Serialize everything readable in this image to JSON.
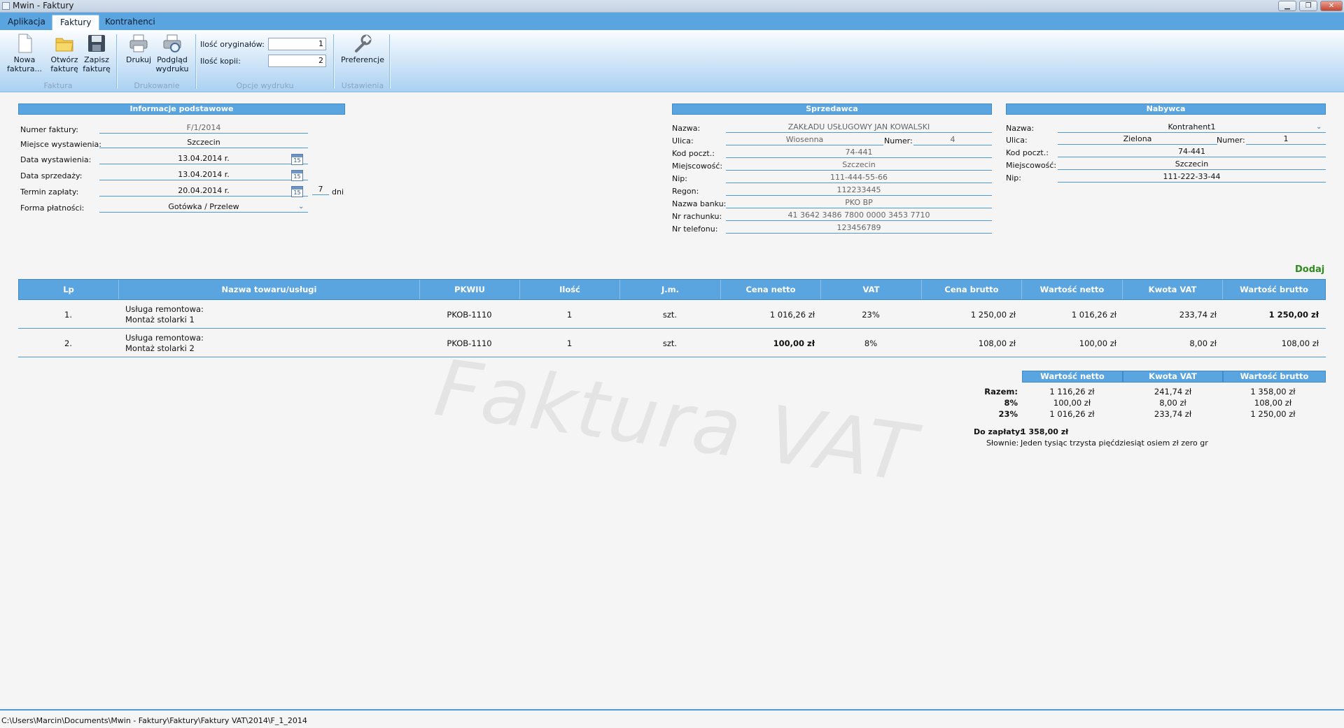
{
  "window": {
    "title": "Mwin - Faktury",
    "minimize": "▁",
    "maximize": "❐",
    "close": "✕"
  },
  "tabs": [
    "Aplikacja",
    "Faktury",
    "Kontrahenci"
  ],
  "ribbon": {
    "new_invoice": "Nowa faktura...",
    "new_invoice_line1": "Nowa",
    "new_invoice_line2": "faktura...",
    "open_line1": "Otwórz",
    "open_line2": "fakturę",
    "save_line1": "Zapisz",
    "save_line2": "fakturę",
    "print": "Drukuj",
    "preview_line1": "Podgląd",
    "preview_line2": "wydruku",
    "originals_label": "Ilość oryginałów:",
    "originals_value": "1",
    "copies_label": "Ilość kopii:",
    "copies_value": "2",
    "preferences": "Preferencje",
    "group_faktura": "Faktura",
    "group_drukowanie": "Drukowanie",
    "group_opcje": "Opcje wydruku",
    "group_ustawienia": "Ustawienia"
  },
  "basic_info": {
    "header": "Informacje podstawowe",
    "number_label": "Numer faktury:",
    "number": "F/1/2014",
    "place_label": "Miejsce wystawienia:",
    "place": "Szczecin",
    "issue_date_label": "Data wystawienia:",
    "issue_date": "13.04.2014 r.",
    "sale_date_label": "Data sprzedaży:",
    "sale_date": "13.04.2014 r.",
    "due_date_label": "Termin zapłaty:",
    "due_date": "20.04.2014 r.",
    "due_days": "7",
    "days_unit": "dni",
    "payment_label": "Forma płatności:",
    "payment": "Gotówka / Przelew",
    "calendar_glyph": "15"
  },
  "seller": {
    "header": "Sprzedawca",
    "name_label": "Nazwa:",
    "name": "ZAKŁADU USŁUGOWY JAN KOWALSKI",
    "street_label": "Ulica:",
    "street": "Wiosenna",
    "number_label": "Numer:",
    "number": "4",
    "postal_label": "Kod poczt.:",
    "postal": "74-441",
    "city_label": "Miejscowość:",
    "city": "Szczecin",
    "nip_label": "Nip:",
    "nip": "111-444-55-66",
    "regon_label": "Regon:",
    "regon": "112233445",
    "bank_label": "Nazwa banku:",
    "bank": "PKO BP",
    "account_label": "Nr rachunku:",
    "account": "41 3642 3486 7800 0000 3453 7710",
    "phone_label": "Nr telefonu:",
    "phone": "123456789"
  },
  "buyer": {
    "header": "Nabywca",
    "name_label": "Nazwa:",
    "name": "Kontrahent1",
    "street_label": "Ulica:",
    "street": "Zielona",
    "number_label": "Numer:",
    "number": "1",
    "postal_label": "Kod poczt.:",
    "postal": "74-441",
    "city_label": "Miejscowość:",
    "city": "Szczecin",
    "nip_label": "Nip:",
    "nip": "111-222-33-44"
  },
  "add_link": "Dodaj",
  "table": {
    "columns": [
      "Lp",
      "Nazwa towaru/usługi",
      "PKWIU",
      "Ilość",
      "J.m.",
      "Cena netto",
      "VAT",
      "Cena brutto",
      "Wartość netto",
      "Kwota VAT",
      "Wartość brutto"
    ],
    "rows": [
      {
        "lp": "1.",
        "name1": "Usługa remontowa:",
        "name2": "Montaż stolarki 1",
        "pkwiu": "PKOB-1110",
        "qty": "1",
        "unit": "szt.",
        "net_price": "1 016,26 zł",
        "vat": "23%",
        "gross_price": "1 250,00 zł",
        "net_value": "1 016,26 zł",
        "vat_amount": "233,74 zł",
        "gross_value": "1 250,00 zł"
      },
      {
        "lp": "2.",
        "name1": "Usługa remontowa:",
        "name2": "Montaż stolarki 2",
        "pkwiu": "PKOB-1110",
        "qty": "1",
        "unit": "szt.",
        "net_price": "100,00 zł",
        "vat": "8%",
        "gross_price": "108,00 zł",
        "net_value": "100,00 zł",
        "vat_amount": "8,00 zł",
        "gross_value": "108,00 zł"
      }
    ]
  },
  "watermark": "Faktura VAT",
  "summary": {
    "columns": [
      "Wartość netto",
      "Kwota VAT",
      "Wartość brutto"
    ],
    "rows": [
      {
        "label": "Razem:",
        "net": "1 116,26 zł",
        "vat": "241,74 zł",
        "gross": "1 358,00 zł"
      },
      {
        "label": "8%",
        "net": "100,00 zł",
        "vat": "8,00 zł",
        "gross": "108,00 zł"
      },
      {
        "label": "23%",
        "net": "1 016,26 zł",
        "vat": "233,74 zł",
        "gross": "1 250,00 zł"
      }
    ],
    "to_pay_label": "Do zapłaty:",
    "to_pay": "1 358,00 zł",
    "words_label": "Słownie:",
    "words": "Jeden tysiąc trzysta pięćdziesiąt osiem zł zero gr"
  },
  "status_path": "C:\\Users\\Marcin\\Documents\\Mwin - Faktury\\Faktury\\Faktury VAT\\2014\\F_1_2014"
}
